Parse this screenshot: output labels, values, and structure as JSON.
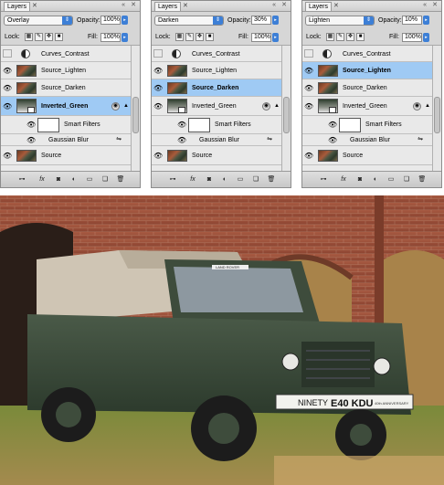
{
  "panels": [
    {
      "tab_label": "Layers",
      "blend_mode": "Overlay",
      "opacity_label": "Opacity:",
      "opacity_value": "100%",
      "lock_label": "Lock:",
      "fill_label": "Fill:",
      "fill_value": "100%",
      "layers": {
        "curves": "Curves_Contrast",
        "lighten": "Source_Lighten",
        "darken": "Source_Darken",
        "inverted": "Inverted_Green",
        "smart_filters": "Smart Filters",
        "gaussian": "Gaussian Blur",
        "source": "Source"
      },
      "selected_layer": "inverted"
    },
    {
      "tab_label": "Layers",
      "blend_mode": "Darken",
      "opacity_label": "Opacity:",
      "opacity_value": "30%",
      "lock_label": "Lock:",
      "fill_label": "Fill:",
      "fill_value": "100%",
      "layers": {
        "curves": "Curves_Contrast",
        "lighten": "Source_Lighten",
        "darken": "Source_Darken",
        "inverted": "Inverted_Green",
        "smart_filters": "Smart Filters",
        "gaussian": "Gaussian Blur",
        "source": "Source"
      },
      "selected_layer": "darken"
    },
    {
      "tab_label": "Layers",
      "blend_mode": "Lighten",
      "opacity_label": "Opacity:",
      "opacity_value": "10%",
      "lock_label": "Lock:",
      "fill_label": "Fill:",
      "fill_value": "100%",
      "layers": {
        "curves": "Curves_Contrast",
        "lighten": "Source_Lighten",
        "darken": "Source_Darken",
        "inverted": "Inverted_Green",
        "smart_filters": "Smart Filters",
        "gaussian": "Gaussian Blur",
        "source": "Source"
      },
      "selected_layer": "lighten"
    }
  ],
  "photo": {
    "plate_text": "E40 KDU",
    "plate_left": "NINETY",
    "plate_right": "40th ANNIVERSARY",
    "windscreen_sticker": "LAND ROVER"
  },
  "colors": {
    "selection": "#9fcaf4",
    "blue_control": "#3d7fd6",
    "vehicle_green": "#3a4a3a",
    "brick": "#9a4a34"
  }
}
